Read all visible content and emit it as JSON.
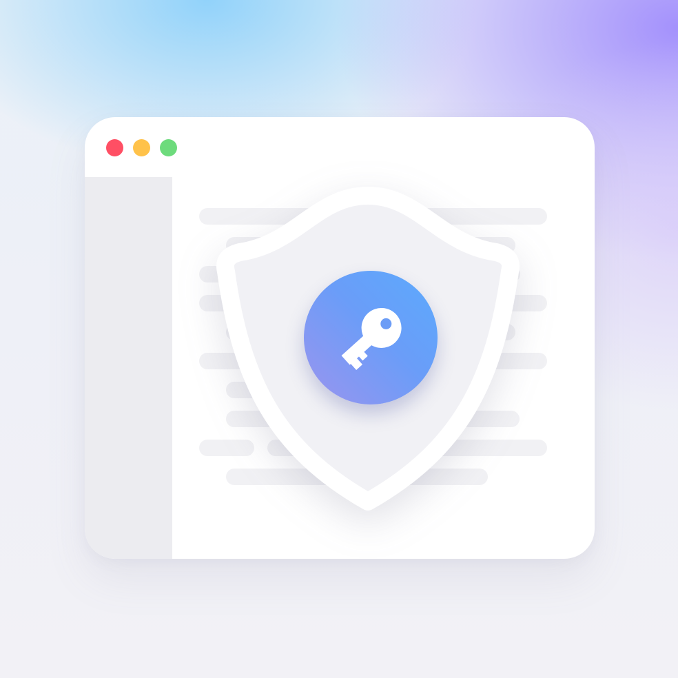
{
  "scene": {
    "window": {
      "controls": [
        "close",
        "minimize",
        "maximize"
      ],
      "control_colors": {
        "close": "#ff4f64",
        "minimize": "#ffc24a",
        "maximize": "#6ddb7c"
      }
    },
    "icons": {
      "shield": "shield-icon",
      "key": "key-icon"
    },
    "colors": {
      "badge_gradient_start": "#5caafd",
      "badge_gradient_end": "#9b94ee",
      "shield_fill": "#f1f1f5",
      "shield_stroke": "#ffffff"
    }
  }
}
